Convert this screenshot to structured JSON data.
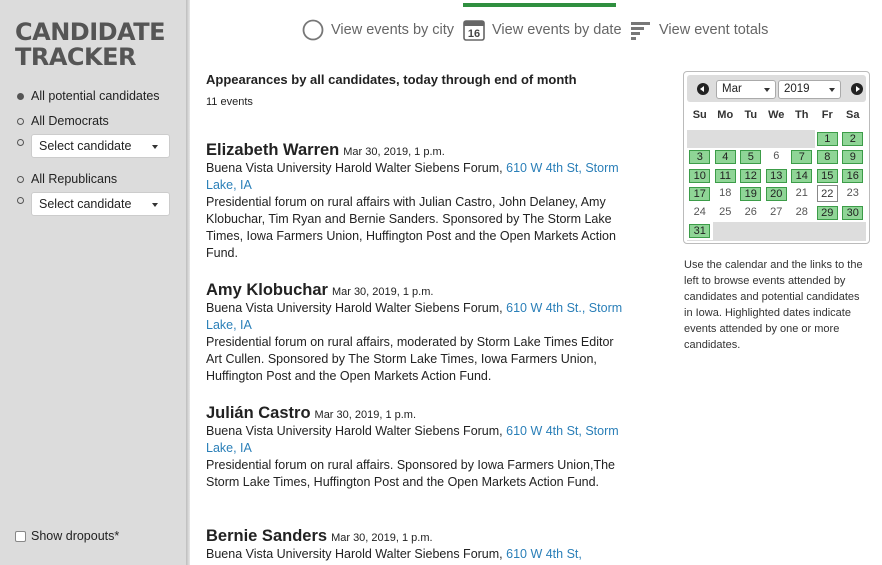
{
  "sidebar": {
    "logo_line1": "CANDIDATE",
    "logo_line2": "TRACKER",
    "all_potential": "All potential candidates",
    "all_democrats": "All Democrats",
    "dem_select": "Select candidate",
    "all_republicans": "All Republicans",
    "rep_select": "Select candidate",
    "show_dropouts": "Show dropouts*"
  },
  "tabs": {
    "city": "View events by city",
    "date": "View events by date",
    "date_icon_number": "16",
    "totals": "View event totals"
  },
  "main": {
    "heading": "Appearances by all candidates, today through end of month",
    "count": "11 events"
  },
  "events": [
    {
      "name": "Elizabeth Warren",
      "date": "Mar 30, 2019, 1 p.m.",
      "venue": "Buena Vista University Harold Walter Siebens Forum, ",
      "address": "610 W 4th St, Storm Lake, IA",
      "description": "Presidential forum on rural affairs with Julian Castro, John Delaney, Amy Klobuchar, Tim Ryan and Bernie Sanders. Sponsored by The Storm Lake Times, Iowa Farmers Union, Huffington Post and the Open Markets Action Fund."
    },
    {
      "name": "Amy Klobuchar",
      "date": "Mar 30, 2019, 1 p.m.",
      "venue": "Buena Vista University Harold Walter Siebens Forum, ",
      "address": "610 W 4th St., Storm Lake, IA",
      "description": "Presidential forum on rural affairs, moderated by Storm Lake Times Editor Art Cullen. Sponsored by The Storm Lake Times, Iowa Farmers Union, Huffington Post and the Open Markets Action Fund."
    },
    {
      "name": "Julián Castro",
      "date": "Mar 30, 2019, 1 p.m.",
      "venue": "Buena Vista University Harold Walter Siebens Forum, ",
      "address": "610 W 4th St, Storm Lake, IA",
      "description": "Presidential forum on rural affairs. Sponsored by Iowa Farmers Union,The Storm Lake Times, Huffington Post and the Open Markets Action Fund."
    },
    {
      "name": "Bernie Sanders",
      "date": "Mar 30, 2019, 1 p.m.",
      "venue": "Buena Vista University Harold Walter Siebens Forum, ",
      "address": "610 W 4th St,",
      "description": ""
    }
  ],
  "calendar": {
    "month": "Mar",
    "year": "2019",
    "weekdays": [
      "Su",
      "Mo",
      "Tu",
      "We",
      "Th",
      "Fr",
      "Sa"
    ],
    "first_weekday": 5,
    "days_in_month": 31,
    "today": 22,
    "highlighted": [
      1,
      2,
      3,
      4,
      5,
      7,
      8,
      9,
      10,
      11,
      12,
      13,
      14,
      15,
      16,
      17,
      19,
      20,
      29,
      30,
      31
    ],
    "note": "Use the calendar and the links to the left to browse events attended by candidates and potential candidates in Iowa. Highlighted dates indicate events attended by one or more candidates."
  }
}
